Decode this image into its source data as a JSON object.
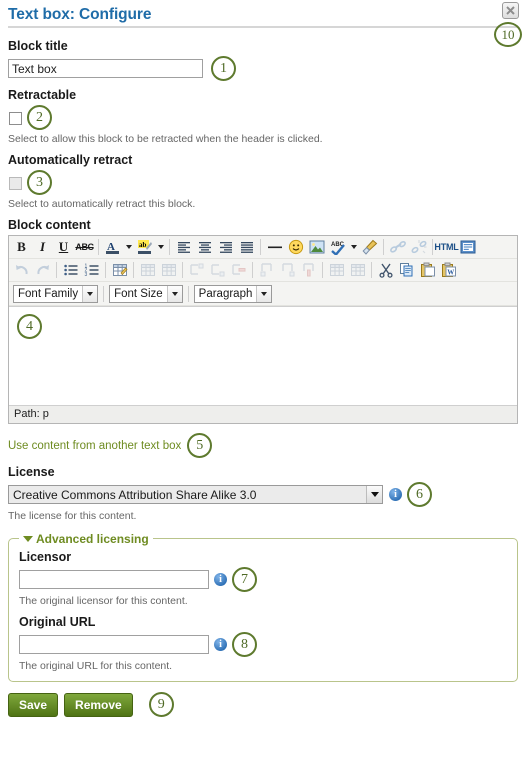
{
  "dialog": {
    "title": "Text box: Configure",
    "close_icon": "close-icon"
  },
  "fields": {
    "block_title": {
      "label": "Block title",
      "value": "Text box"
    },
    "retractable": {
      "label": "Retractable",
      "help": "Select to allow this block to be retracted when the header is clicked.",
      "checked": false
    },
    "auto_retract": {
      "label": "Automatically retract",
      "help": "Select to automatically retract this block.",
      "checked": false,
      "disabled": true
    },
    "block_content": {
      "label": "Block content"
    },
    "license": {
      "label": "License",
      "value": "Creative Commons Attribution Share Alike 3.0",
      "help": "The license for this content."
    },
    "licensor": {
      "label": "Licensor",
      "value": "",
      "help": "The original licensor for this content."
    },
    "original_url": {
      "label": "Original URL",
      "value": "",
      "help": "The original URL for this content."
    }
  },
  "editor": {
    "toolbar_row1": [
      {
        "name": "bold-icon",
        "label": "B",
        "kind": "bold"
      },
      {
        "name": "italic-icon",
        "label": "I",
        "kind": "italic"
      },
      {
        "name": "underline-icon",
        "label": "U",
        "kind": "underline"
      },
      {
        "name": "strikethrough-icon",
        "label": "ABC",
        "kind": "strike"
      },
      {
        "name": "separator",
        "kind": "sep"
      },
      {
        "name": "text-color-icon",
        "kind": "forecolor"
      },
      {
        "name": "chevron-down-icon",
        "kind": "arrow"
      },
      {
        "name": "highlight-color-icon",
        "kind": "backcolor"
      },
      {
        "name": "chevron-down-icon",
        "kind": "arrow"
      },
      {
        "name": "separator",
        "kind": "sep"
      },
      {
        "name": "align-left-icon",
        "kind": "align-left"
      },
      {
        "name": "align-center-icon",
        "kind": "align-center"
      },
      {
        "name": "align-right-icon",
        "kind": "align-right"
      },
      {
        "name": "align-justify-icon",
        "kind": "align-justify"
      },
      {
        "name": "separator",
        "kind": "sep"
      },
      {
        "name": "horizontal-rule-icon",
        "kind": "hr"
      },
      {
        "name": "emoticon-icon",
        "kind": "smiley"
      },
      {
        "name": "insert-image-icon",
        "kind": "image"
      },
      {
        "name": "spellcheck-icon",
        "kind": "spell"
      },
      {
        "name": "chevron-down-icon",
        "kind": "arrow"
      },
      {
        "name": "remove-formatting-icon",
        "kind": "broom"
      },
      {
        "name": "separator",
        "kind": "sep"
      },
      {
        "name": "insert-link-icon",
        "kind": "link",
        "disabled": true
      },
      {
        "name": "unlink-icon",
        "kind": "unlink",
        "disabled": true
      },
      {
        "name": "separator",
        "kind": "sep"
      },
      {
        "name": "html-source-icon",
        "kind": "html"
      },
      {
        "name": "fullscreen-icon",
        "kind": "fullscreen"
      }
    ],
    "toolbar_row2": [
      {
        "name": "undo-icon",
        "kind": "undo",
        "disabled": true
      },
      {
        "name": "redo-icon",
        "kind": "redo",
        "disabled": true
      },
      {
        "name": "separator",
        "kind": "sep"
      },
      {
        "name": "bullet-list-icon",
        "kind": "ul"
      },
      {
        "name": "numbered-list-icon",
        "kind": "ol"
      },
      {
        "name": "separator",
        "kind": "sep"
      },
      {
        "name": "insert-table-icon",
        "kind": "table"
      },
      {
        "name": "separator",
        "kind": "sep"
      },
      {
        "name": "table-row-properties-icon",
        "kind": "trprops",
        "disabled": true
      },
      {
        "name": "table-cell-properties-icon",
        "kind": "tdprops",
        "disabled": true
      },
      {
        "name": "separator",
        "kind": "sep"
      },
      {
        "name": "insert-row-before-icon",
        "kind": "rowbefore",
        "disabled": true
      },
      {
        "name": "insert-row-after-icon",
        "kind": "rowafter",
        "disabled": true
      },
      {
        "name": "delete-row-icon",
        "kind": "delrow",
        "disabled": true
      },
      {
        "name": "separator",
        "kind": "sep"
      },
      {
        "name": "insert-column-before-icon",
        "kind": "colbefore",
        "disabled": true
      },
      {
        "name": "insert-column-after-icon",
        "kind": "colafter",
        "disabled": true
      },
      {
        "name": "delete-column-icon",
        "kind": "delcol",
        "disabled": true
      },
      {
        "name": "separator",
        "kind": "sep"
      },
      {
        "name": "split-cells-icon",
        "kind": "split",
        "disabled": true
      },
      {
        "name": "merge-cells-icon",
        "kind": "merge",
        "disabled": true
      },
      {
        "name": "separator",
        "kind": "sep"
      },
      {
        "name": "cut-icon",
        "kind": "cut"
      },
      {
        "name": "copy-icon",
        "kind": "copy"
      },
      {
        "name": "paste-icon",
        "kind": "paste"
      },
      {
        "name": "paste-from-word-icon",
        "kind": "pasteword"
      }
    ],
    "font_family": "Font Family",
    "font_size": "Font Size",
    "paragraph": "Paragraph",
    "path_bar": "Path: p",
    "content": ""
  },
  "links": {
    "use_content": "Use content from another text box"
  },
  "advanced": {
    "legend": "Advanced licensing"
  },
  "buttons": {
    "save": "Save",
    "remove": "Remove"
  },
  "markers": {
    "m1": "1",
    "m2": "2",
    "m3": "3",
    "m4": "4",
    "m5": "5",
    "m6": "6",
    "m7": "7",
    "m8": "8",
    "m9": "9",
    "m10": "10"
  },
  "colors": {
    "title_blue": "#1f6ca8",
    "marker_green": "#5e7a2e",
    "link_green": "#6f8c22",
    "button_green": "#5f8a1c"
  }
}
